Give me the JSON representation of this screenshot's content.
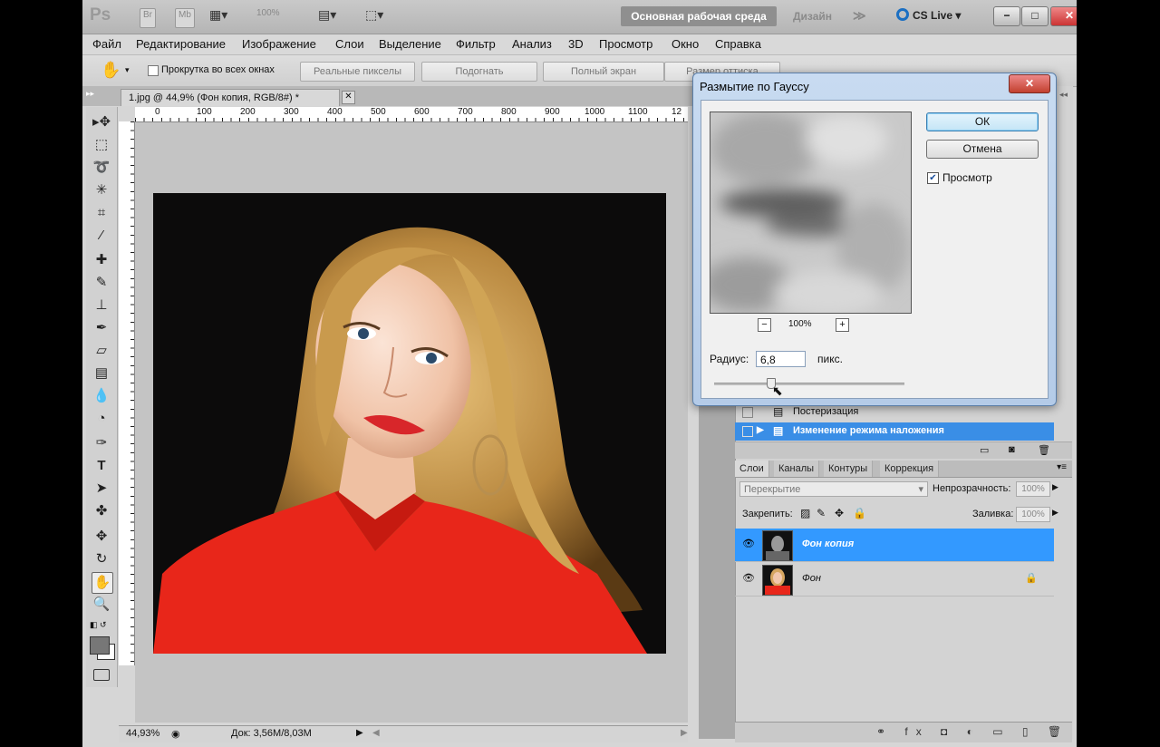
{
  "appbar": {
    "logo": "Ps",
    "bridge": "Br",
    "mini_bridge": "Mb",
    "zoom": "100%",
    "workspace": "Основная рабочая среда",
    "design": "Дизайн",
    "more": "≫",
    "cslive": "CS Live ▾",
    "minimize": "−",
    "maximize": "□",
    "close": "✕"
  },
  "menu": [
    "Файл",
    "Редактирование",
    "Изображение",
    "Слои",
    "Выделение",
    "Фильтр",
    "Анализ",
    "3D",
    "Просмотр",
    "Окно",
    "Справка"
  ],
  "options": {
    "scroll_all": "Прокрутка во всех окнах",
    "actual_pixels": "Реальные пикселы",
    "fit": "Подогнать",
    "full_screen": "Полный экран",
    "print_size": "Размер оттиска"
  },
  "document": {
    "tab_title": "1.jpg @ 44,9% (Фон копия, RGB/8#) *",
    "close": "✕",
    "zoom": "44,93%",
    "doc_info": "Док: 3,56M/8,03M"
  },
  "ruler_labels": [
    "0",
    "100",
    "200",
    "300",
    "400",
    "500",
    "600",
    "700",
    "800",
    "900",
    "1000",
    "1100",
    "12"
  ],
  "dialog": {
    "title": "Размытие по Гауссу",
    "close": "✕",
    "ok": "ОК",
    "cancel": "Отмена",
    "preview_label": "Просмотр",
    "preview_checked": true,
    "zoom_level": "100%",
    "zoom_out": "−",
    "zoom_in": "+",
    "radius_label": "Радиус:",
    "radius_value": "6,8",
    "radius_unit": "пикс."
  },
  "actions": {
    "items": [
      "Постеризация",
      "Изменение режима наложения"
    ]
  },
  "layers_panel": {
    "tabs": [
      "Слои",
      "Каналы",
      "Контуры",
      "Коррекция"
    ],
    "blend_mode": "Перекрытие",
    "opacity_label": "Непрозрачность:",
    "opacity_value": "100%",
    "lock_label": "Закрепить:",
    "fill_label": "Заливка:",
    "fill_value": "100%",
    "layers": [
      {
        "name": "Фон копия",
        "selected": true
      },
      {
        "name": "Фон",
        "selected": false
      }
    ],
    "footer_icons": "⚭ fx ◘ ◐ ▭ ▯ 🗑"
  },
  "colors": {
    "accent": "#3399ff",
    "dialog_frame": "#b4cbe8",
    "shirt": "#e8261a"
  }
}
